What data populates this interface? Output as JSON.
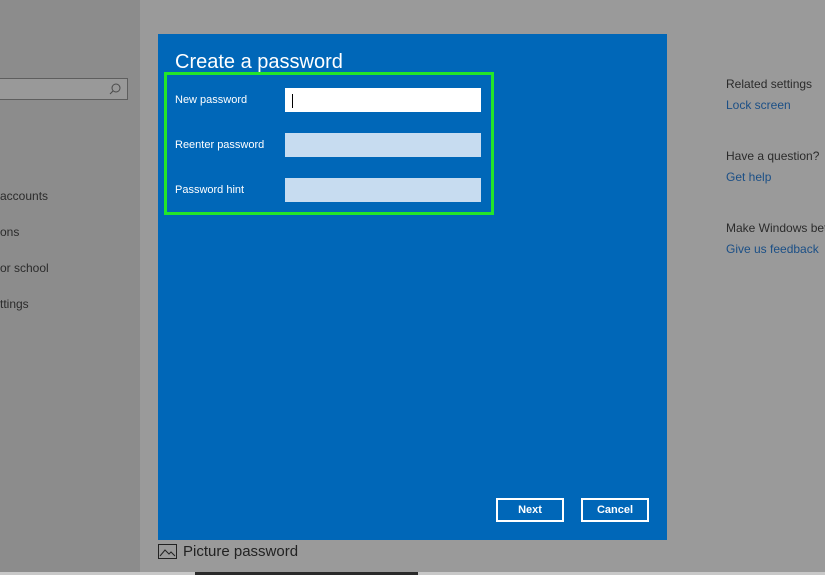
{
  "sidebar": {
    "items": [
      {
        "label": "accounts"
      },
      {
        "label": "ons"
      },
      {
        "label": "or school"
      },
      {
        "label": "ttings"
      }
    ]
  },
  "related": {
    "heading": "Related settings",
    "lock_screen": "Lock screen",
    "question_heading": "Have a question?",
    "get_help": "Get help",
    "better_heading": "Make Windows bett",
    "feedback": "Give us feedback"
  },
  "picture_password": {
    "label": "Picture password",
    "icon": "image-icon"
  },
  "dialog": {
    "title": "Create a password",
    "fields": [
      {
        "label": "New password",
        "value": ""
      },
      {
        "label": "Reenter password",
        "value": ""
      },
      {
        "label": "Password hint",
        "value": ""
      }
    ],
    "next_label": "Next",
    "cancel_label": "Cancel",
    "highlight_color": "#23e62a",
    "background_color": "#0067b8"
  }
}
